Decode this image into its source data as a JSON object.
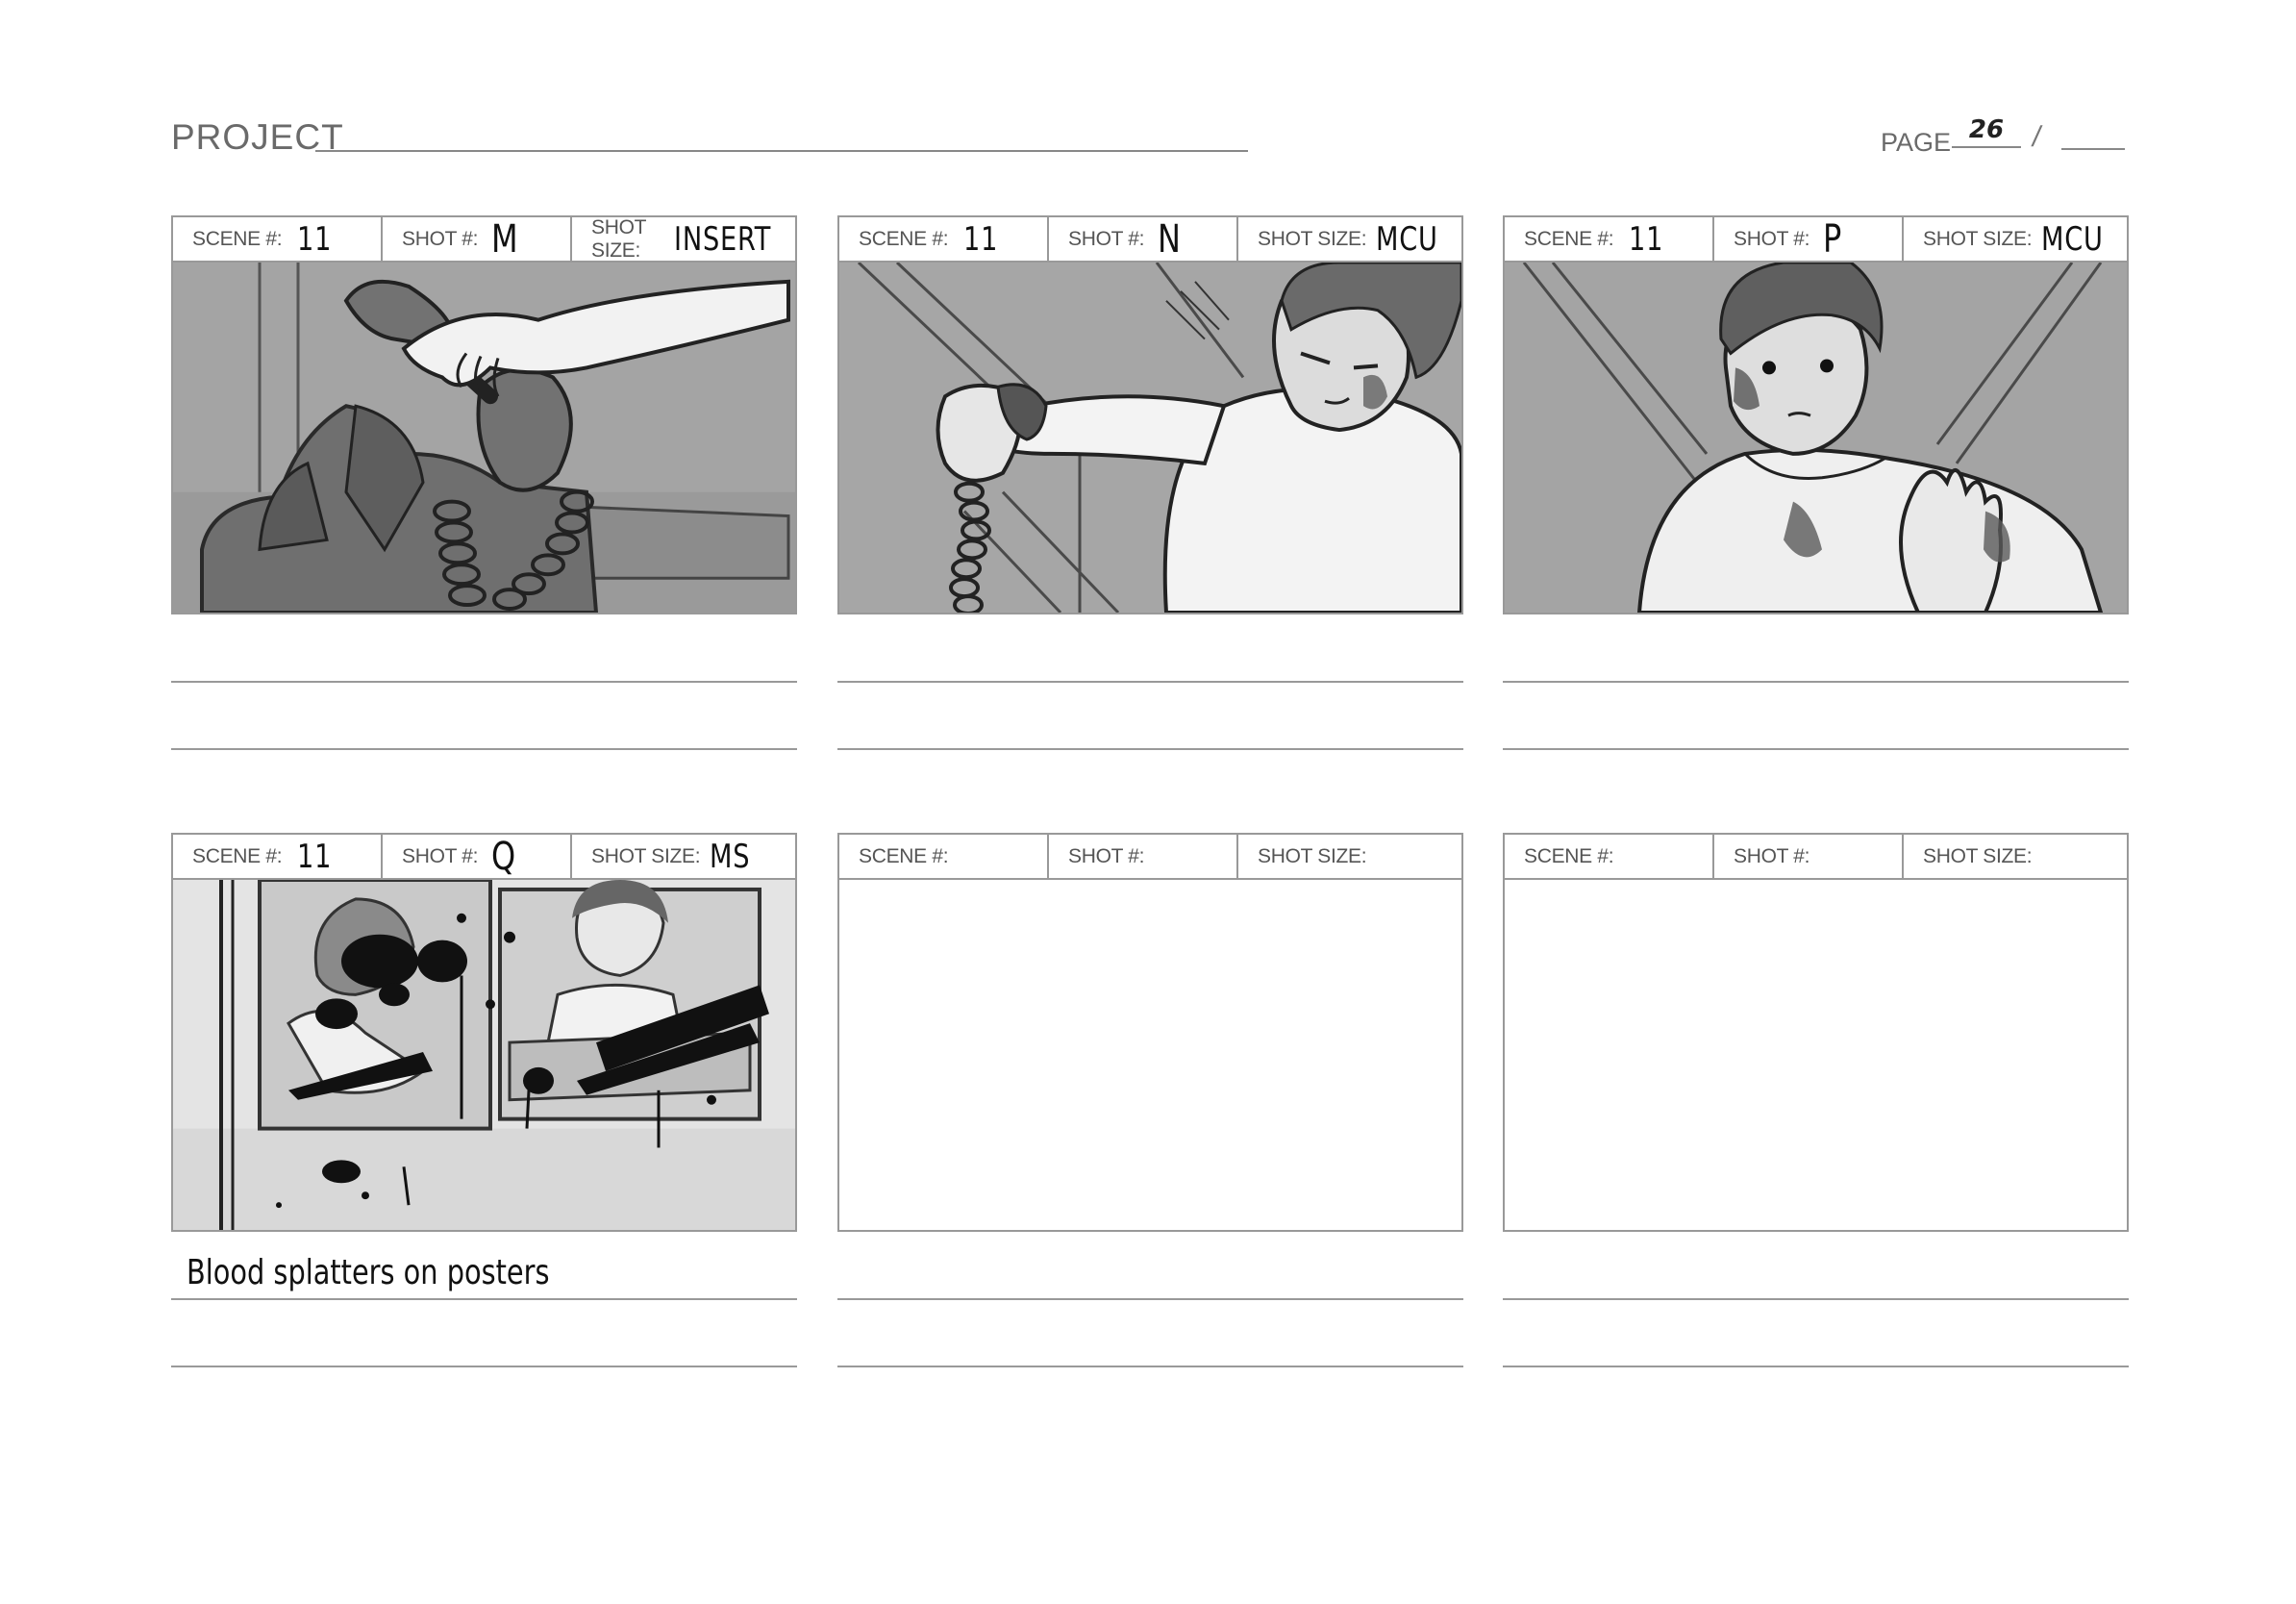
{
  "header": {
    "project_label": "PROJECT",
    "page_label": "PAGE",
    "page_number": "26",
    "page_separator": "/"
  },
  "labels": {
    "scene": "SCENE #:",
    "shot": "SHOT #:",
    "shot_size": "SHOT SIZE:"
  },
  "panels": [
    {
      "scene": "11",
      "shot": "M",
      "shot_size": "INSERT",
      "caption": ""
    },
    {
      "scene": "11",
      "shot": "N",
      "shot_size": "MCU",
      "caption": ""
    },
    {
      "scene": "11",
      "shot": "P",
      "shot_size": "MCU",
      "caption": ""
    },
    {
      "scene": "11",
      "shot": "Q",
      "shot_size": "MS",
      "caption": "Blood splatters on posters"
    },
    {
      "scene": "",
      "shot": "",
      "shot_size": "",
      "caption": ""
    },
    {
      "scene": "",
      "shot": "",
      "shot_size": "",
      "caption": ""
    }
  ],
  "sketch_art": {
    "panel_1": "hand-holding-telephone-receiver",
    "panel_2": "boy-slamming-receiver-down",
    "panel_3": "bruised-boy-with-raised-hand",
    "panel_4": "blood-splattered-posters"
  }
}
